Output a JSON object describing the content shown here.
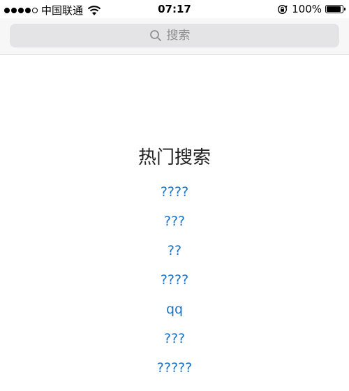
{
  "status_bar": {
    "carrier": "中国联通",
    "time": "07:17",
    "battery": "100%",
    "battery_level": 1.0,
    "signal_bars": 4,
    "signal_total": 5
  },
  "search": {
    "placeholder": "搜索"
  },
  "hot_search": {
    "title": "热门搜索",
    "items": [
      "????",
      "???",
      "??",
      "????",
      "qq",
      "???",
      "?????"
    ]
  },
  "colors": {
    "link": "#1a73c8",
    "search_field": "#e4e4e6",
    "nav_background": "#f7f7f7"
  }
}
